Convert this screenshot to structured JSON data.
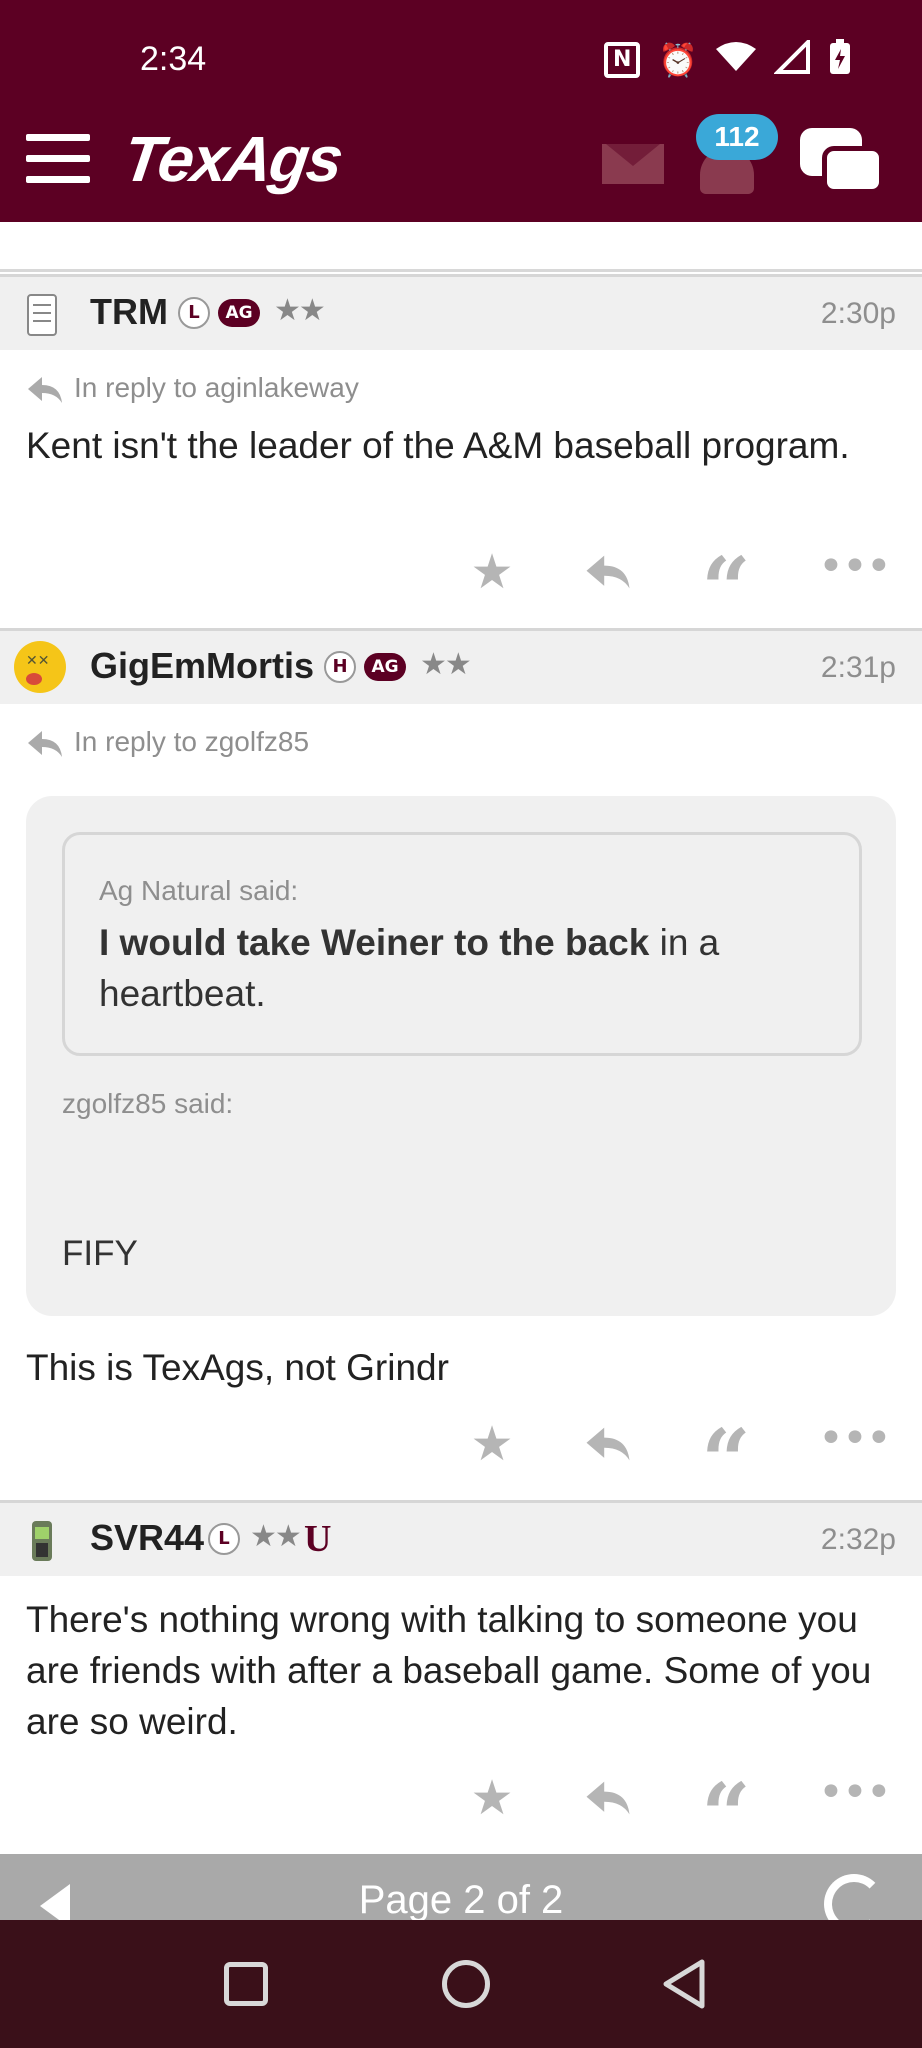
{
  "status_bar": {
    "time": "2:34"
  },
  "app": {
    "logo": "TexAgs",
    "notification_count": "112"
  },
  "posts": [
    {
      "username": "TRM",
      "badges": [
        "L",
        "AG"
      ],
      "stars": "★★",
      "time": "2:30p",
      "reply_to": "In reply to aginlakeway",
      "text": "Kent isn't the leader of the A&M baseball program."
    },
    {
      "username": "GigEmMortis",
      "badges": [
        "H",
        "AG"
      ],
      "stars": "★★",
      "time": "2:31p",
      "reply_to": "In reply to zgolfz85",
      "nested_quote": {
        "author": "Ag Natural said:",
        "text_bold": "I would take Weiner to the back",
        "text_rest": " in a heartbeat."
      },
      "quote": {
        "author": "zgolfz85 said:",
        "text": "FIFY"
      },
      "text": "This is TexAgs, not Grindr"
    },
    {
      "username": "SVR44",
      "badges": [
        "L"
      ],
      "stars": "★★",
      "extra_badge": "U",
      "time": "2:32p",
      "text": "There's nothing wrong with talking to someone you are friends with after a baseball game. Some of you are so weird."
    }
  ],
  "actions": {
    "star": "★",
    "quote": "“",
    "more": "•••"
  },
  "pager": {
    "label": "Page 2 of 2"
  },
  "icons": [
    "menu-icon",
    "mail-icon",
    "bell-icon",
    "chat-icon",
    "star-icon",
    "reply-icon",
    "quote-icon",
    "more-icon"
  ],
  "colors": {
    "brand": "#5c0023",
    "badge_blue": "#3aa8d8"
  }
}
